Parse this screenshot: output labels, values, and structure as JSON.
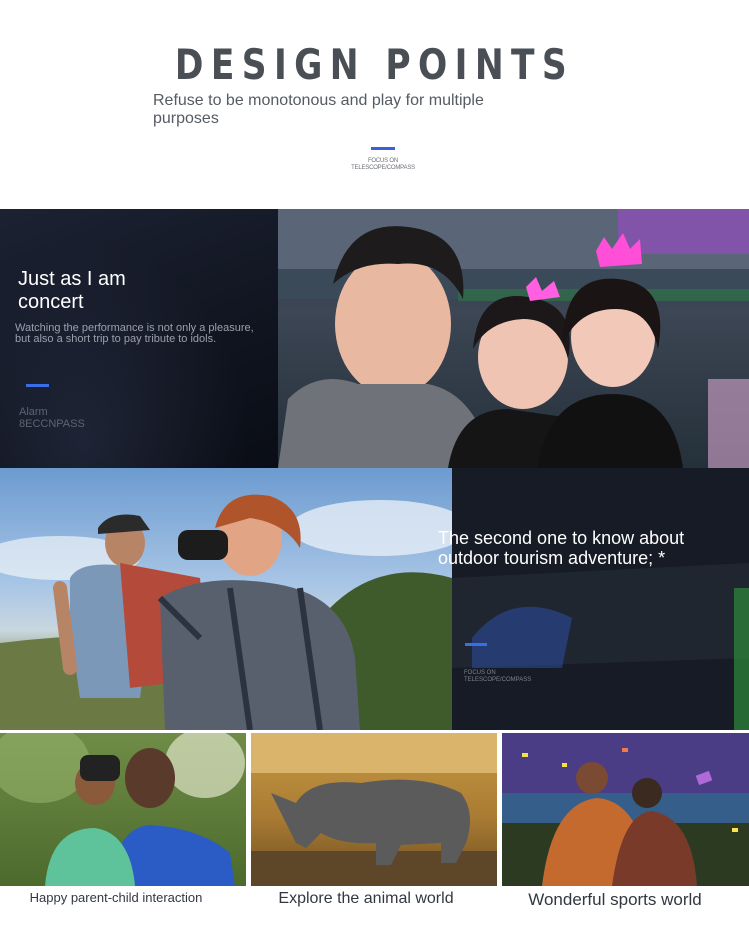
{
  "header": {
    "title": "DESIGN POINTS",
    "subtitle": "Refuse to be monotonous and play for multiple purposes",
    "focus_line1": "FOCUS ON",
    "focus_line2": "TELESCOPE/COMPASS"
  },
  "concert": {
    "heading_line1": "Just as I am",
    "heading_line2": "concert",
    "text": "Watching the performance is not only a pleasure, but also a short trip to pay tribute to idols.",
    "alarm_line1": "Alarm",
    "alarm_line2": "8ECCNPASS"
  },
  "outdoor": {
    "heading": "The second one to know about outdoor tourism adventure; *",
    "focus_line1": "FOCUS ON",
    "focus_line2": "TELESCOPE/COMPASS"
  },
  "thumbnails": [
    {
      "caption": "Happy parent-child interaction"
    },
    {
      "caption": "Explore the animal world"
    },
    {
      "caption": "Wonderful sports world"
    }
  ],
  "colors": {
    "accent_blue": "#3a6ee8",
    "title_gray": "#4a4f55",
    "dark_panel": "#10141f",
    "crown_pink": "#ff4fd8"
  }
}
